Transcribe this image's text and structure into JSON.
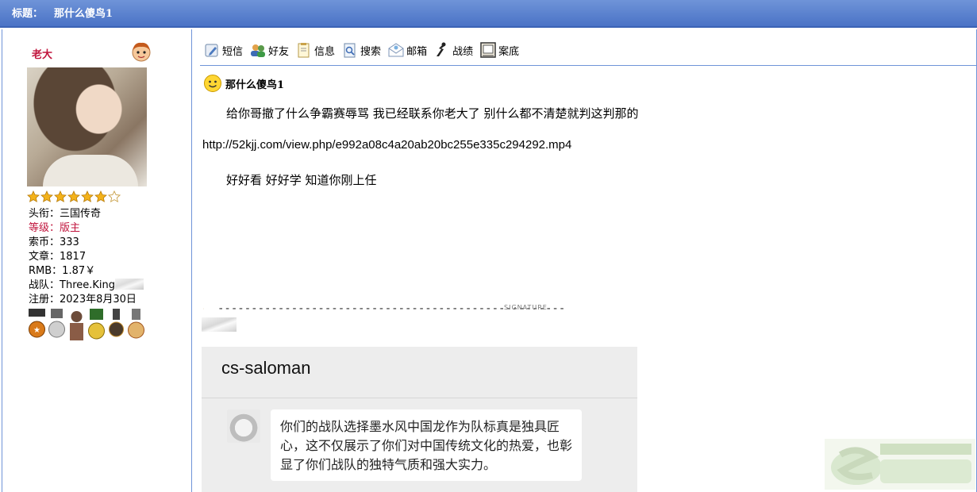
{
  "header": {
    "label": "标题：",
    "title": "那什么傻鸟1"
  },
  "user": {
    "name": "老大",
    "rank_stars": {
      "filled": 6,
      "total": 7
    },
    "info": {
      "title_label": "头衔：",
      "title_value": "三国传奇",
      "level_label": "等级：",
      "level_value": "版主",
      "coins_label": "索币：",
      "coins_value": "333",
      "posts_label": "文章：",
      "posts_value": "1817",
      "rmb_label": "RMB：",
      "rmb_value": "1.87￥",
      "team_label": "战队：",
      "team_value": "Three.King",
      "registered_label": "注册：",
      "registered_value": "2023年8月30日"
    }
  },
  "toolbar": {
    "items": [
      {
        "label": "短信",
        "icon": "sms-icon"
      },
      {
        "label": "好友",
        "icon": "friends-icon"
      },
      {
        "label": "信息",
        "icon": "info-icon"
      },
      {
        "label": "搜索",
        "icon": "search-icon"
      },
      {
        "label": "邮箱",
        "icon": "mail-icon"
      },
      {
        "label": "战绩",
        "icon": "stats-icon"
      },
      {
        "label": "案底",
        "icon": "record-icon"
      }
    ]
  },
  "post": {
    "title": "那什么傻鸟1",
    "paragraph1": "给你哥撤了什么争霸赛辱骂  我已经联系你老大了 别什么都不清楚就判这判那的",
    "link": "http://52kjj.com/view.php/e992a08c4a20ab20bc255e335c294292.mp4",
    "paragraph3": "好好看 好好学 知道你刚上任"
  },
  "signature": {
    "label": "SIGNATURE",
    "dashes": "----------------------------------------------------"
  },
  "chat": {
    "header": "cs-saloman",
    "message": "你们的战队选择墨水风中国龙作为队标真是独具匠心，这不仅展示了你们对中国传统文化的热爱，也彰显了你们战队的独特气质和强大实力。"
  },
  "colors": {
    "header_bg": "#5a80cf",
    "username": "#c0143c",
    "border": "#6f94d8"
  }
}
